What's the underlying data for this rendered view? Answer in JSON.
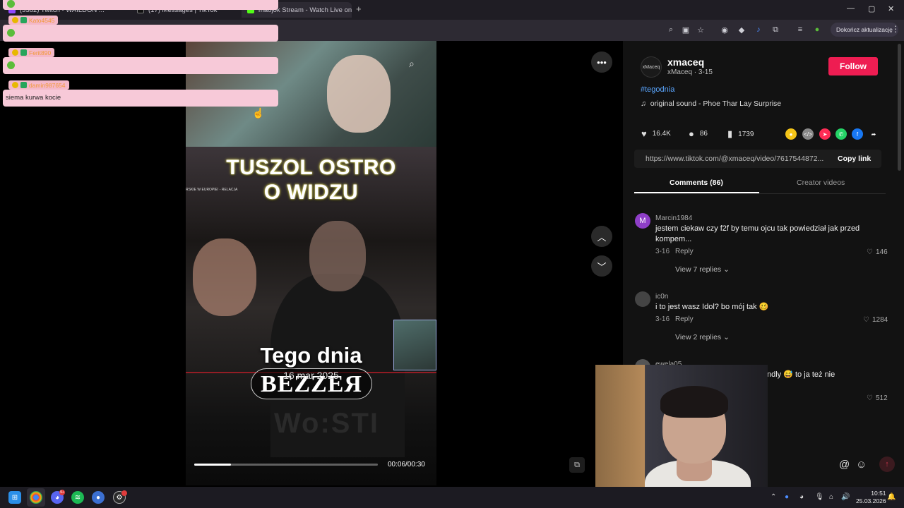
{
  "browser": {
    "tabs": [
      {
        "label": "(3382) Twitch - WAILDON ...",
        "color": "#9146ff"
      },
      {
        "label": "(17) Messages | TikTok",
        "color": "#111111"
      },
      {
        "label": "maojok Stream - Watch Live on",
        "color": "#53fc18"
      }
    ],
    "new_tab_label": "+",
    "update_button": "Dokończ aktualizację",
    "window_controls": [
      "—",
      "▢",
      "✕"
    ]
  },
  "chat": {
    "messages": [
      {
        "user": "Kato4545",
        "text": ""
      },
      {
        "user": "Ferit890",
        "text": ""
      },
      {
        "user": "damin987654",
        "text": "siema kurwa kocie"
      }
    ]
  },
  "video": {
    "title_line1": "TUSZOL OSTRO",
    "title_line2": "O WIDZU",
    "source_label": "RSKIE W EUROPIE! - RELACJA",
    "caption": "Tego dnia",
    "date": "16 mar 2025",
    "logo_text": "BEZZEЯ",
    "ghost_text": "Wo:STI",
    "time": "00:06/00:30",
    "progress": 0.2,
    "more_icon": "more-icon",
    "up_icon": "chevron-up-icon",
    "down_icon": "chevron-down-icon"
  },
  "creator": {
    "username": "xmaceq",
    "display_name": "xMaceq · 3-15",
    "avatar_text": "xMaceq",
    "follow_label": "Follow",
    "hashtag": "#tegodnia",
    "music": "original sound - Phoe Thar Lay Surprise"
  },
  "stats": {
    "likes": "16.4K",
    "comments": "86",
    "saves": "1739"
  },
  "link": {
    "url": "https://www.tiktok.com/@xmaceq/video/7617544872...",
    "copy_label": "Copy link"
  },
  "tabs": {
    "comments": "Comments (86)",
    "creator_videos": "Creator videos"
  },
  "comments": [
    {
      "avatar": "M",
      "avatar_color": "#8e3ec7",
      "user": "Marcin1984",
      "text": "jestem ciekaw czy f2f by temu ojcu tak powiedział jak przed kompem...",
      "date": "3-16",
      "reply": "Reply",
      "likes": "146",
      "view_replies": "View 7 replies"
    },
    {
      "avatar": "",
      "avatar_color": "#444444",
      "user": "ic0n",
      "text": "i to jest wasz Idol? bo mój tak 🥴",
      "date": "3-16",
      "reply": "Reply",
      "likes": "1284",
      "view_replies": "View 2 replies"
    },
    {
      "avatar": "",
      "avatar_color": "#555555",
      "user": "ewela05",
      "text": "ndly 😅 to ja też nie",
      "date": "",
      "reply": "",
      "likes": "512",
      "view_replies": ""
    }
  ],
  "taskbar": {
    "clock_time": "10:51",
    "clock_date": "25.03.2026",
    "discord_badge": "9+"
  }
}
